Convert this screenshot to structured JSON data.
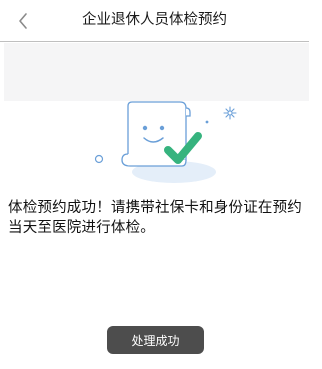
{
  "header": {
    "title": "企业退休人员体检预约"
  },
  "icons": {
    "back": "chevron-left-icon",
    "illustration": "document-success-illustration"
  },
  "result": {
    "message": "体检预约成功！请携带社保卡和身份证在预约当天至医院进行体检。"
  },
  "toast": {
    "text": "处理成功"
  },
  "colors": {
    "accent_green": "#36b37e",
    "doc_outline": "#6a9fd8",
    "shadow_blue": "#e4eef9",
    "toast_bg": "#4d4d4d",
    "band_bg": "#f5f5f6"
  }
}
